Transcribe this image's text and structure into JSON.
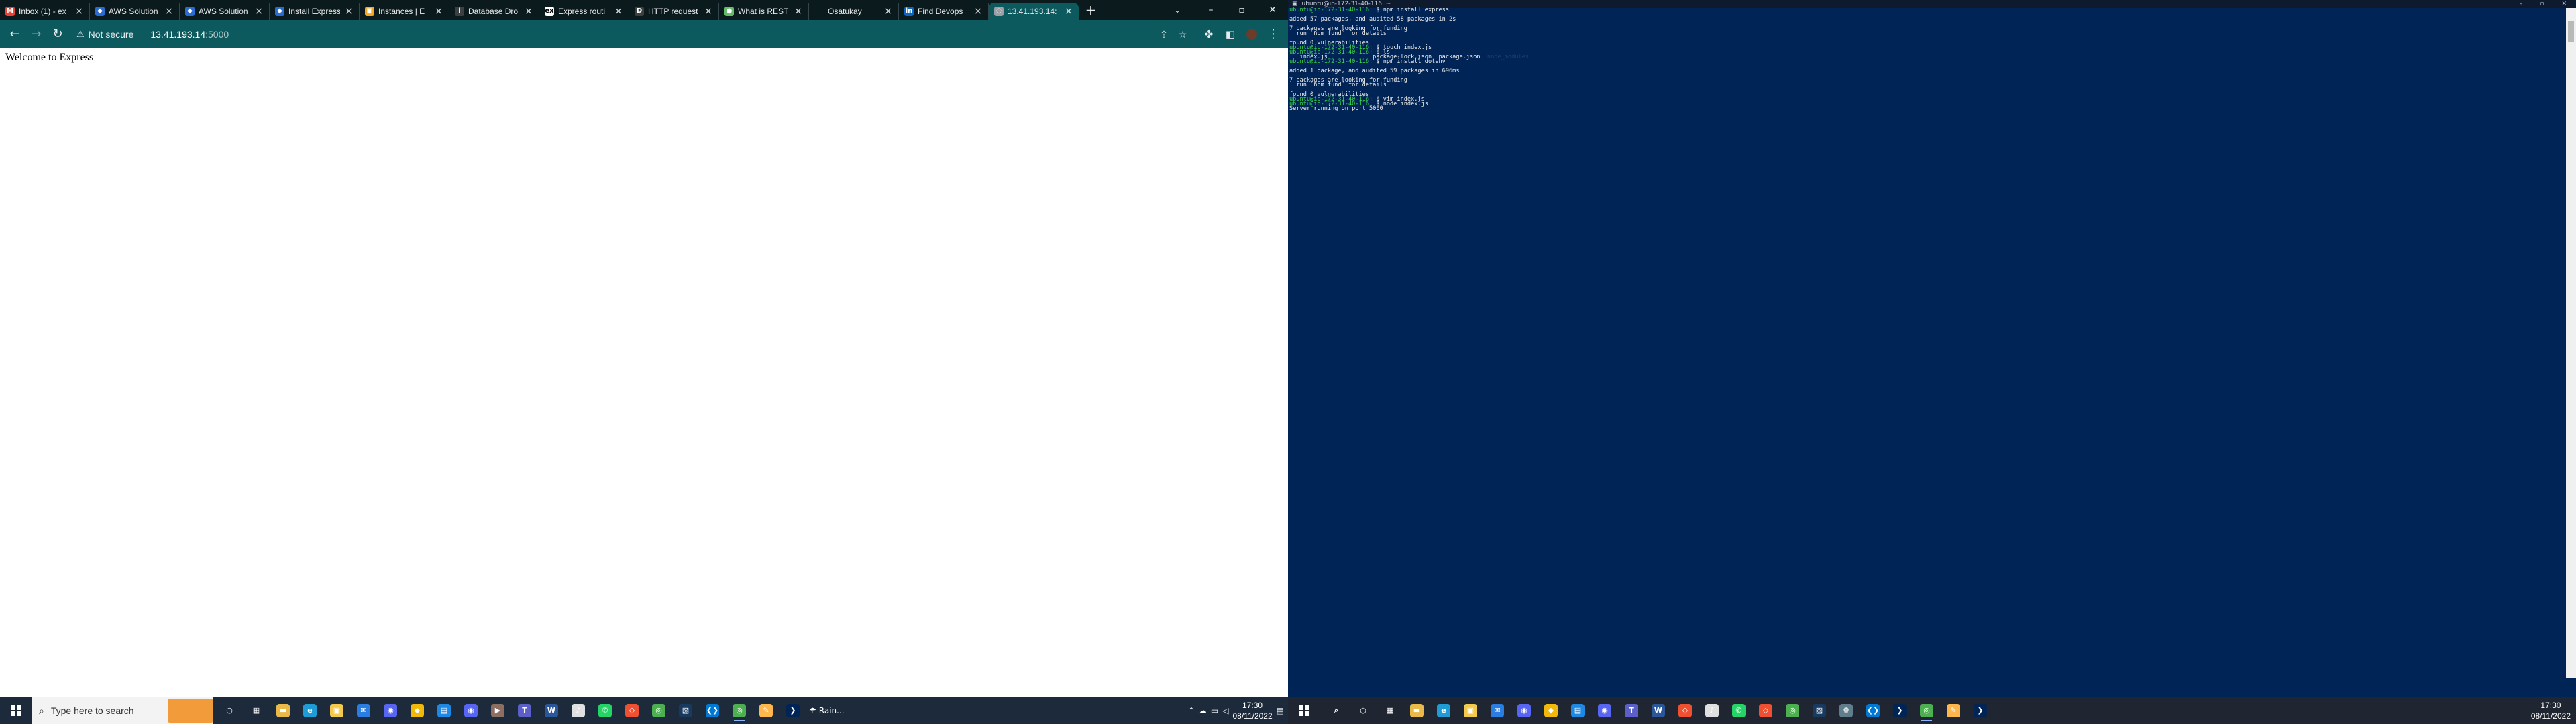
{
  "browser": {
    "tabs": [
      {
        "label": "Inbox (1) - ex",
        "icon": "gmail-icon",
        "color": "#ea4335",
        "glyph": "M"
      },
      {
        "label": "AWS Solution",
        "icon": "aws-icon",
        "color": "#2b6cd4",
        "glyph": "◆"
      },
      {
        "label": "AWS Solution",
        "icon": "aws-icon",
        "color": "#2b6cd4",
        "glyph": "◆"
      },
      {
        "label": "Install Express",
        "icon": "aws-icon",
        "color": "#2b6cd4",
        "glyph": "◆"
      },
      {
        "label": "Instances | E",
        "icon": "aws-console-icon",
        "color": "#f5a623",
        "glyph": "▣"
      },
      {
        "label": "Database Dro",
        "icon": "info-icon",
        "color": "#3c4043",
        "glyph": "i"
      },
      {
        "label": "Express routi",
        "icon": "express-icon",
        "color": "#ffffff",
        "glyph": "ex"
      },
      {
        "label": "HTTP request",
        "icon": "dev-icon",
        "color": "#3c4043",
        "glyph": "D"
      },
      {
        "label": "What is REST",
        "icon": "globe-icon",
        "color": "#66bb6a",
        "glyph": "●"
      },
      {
        "label": "Osatukay",
        "icon": "blank-icon",
        "color": "#0b1a1c",
        "glyph": ""
      },
      {
        "label": "Find Devops",
        "icon": "linkedin-icon",
        "color": "#0a66c2",
        "glyph": "in"
      },
      {
        "label": "13.41.193.14:",
        "icon": "page-icon",
        "color": "#9aa0a6",
        "glyph": "◌",
        "active": true
      }
    ],
    "new_tab_glyph": "+",
    "address": {
      "security": "Not secure",
      "host": "13.41.193.14",
      "port": ":5000"
    },
    "page": {
      "heading": "Welcome to Express"
    }
  },
  "taskbar_left": {
    "search_placeholder": "Type here to search",
    "weather": "Rain...",
    "time": "17:30",
    "date": "08/11/2022",
    "apps": [
      {
        "name": "cortana-icon",
        "color": "#1c2a3b",
        "glyph": "○"
      },
      {
        "name": "task-view-icon",
        "color": "#1c2a3b",
        "glyph": "▦"
      },
      {
        "name": "file-explorer-icon",
        "color": "#e9b949",
        "glyph": "▬"
      },
      {
        "name": "edge-icon",
        "color": "#1f9cd6",
        "glyph": "e"
      },
      {
        "name": "store-icon",
        "color": "#f2c94c",
        "glyph": "▣"
      },
      {
        "name": "mail-icon",
        "color": "#2a7de1",
        "glyph": "✉"
      },
      {
        "name": "discord-icon",
        "color": "#5865f2",
        "glyph": "◉"
      },
      {
        "name": "binance-icon",
        "color": "#f0b90b",
        "glyph": "◆"
      },
      {
        "name": "app-blue-icon",
        "color": "#1e88e5",
        "glyph": "▤"
      },
      {
        "name": "discord-icon",
        "color": "#5865f2",
        "glyph": "◉"
      },
      {
        "name": "media-icon",
        "color": "#8d6e63",
        "glyph": "▶"
      },
      {
        "name": "teams-icon",
        "color": "#5b5fc7",
        "glyph": "T"
      },
      {
        "name": "word-icon",
        "color": "#2b579a",
        "glyph": "W"
      },
      {
        "name": "itunes-icon",
        "color": "#e0e0e0",
        "glyph": "♪"
      },
      {
        "name": "whatsapp-icon",
        "color": "#25d366",
        "glyph": "✆"
      },
      {
        "name": "git-icon",
        "color": "#f05032",
        "glyph": "◇"
      },
      {
        "name": "chrome-icon",
        "color": "#4caf50",
        "glyph": "◎"
      },
      {
        "name": "virtualbox-icon",
        "color": "#183a61",
        "glyph": "▨"
      },
      {
        "name": "vscode-icon",
        "color": "#0078d4",
        "glyph": "❮❯"
      },
      {
        "name": "chrome-icon",
        "color": "#4caf50",
        "glyph": "◎",
        "running": true
      },
      {
        "name": "notepad-icon",
        "color": "#ffb74d",
        "glyph": "✎"
      },
      {
        "name": "powershell-icon",
        "color": "#012456",
        "glyph": "❯"
      }
    ]
  },
  "terminal": {
    "title": "ubuntu@ip-172-31-40-116: ~",
    "lines": [
      {
        "prompt": "ubuntu@ip-172-31-40-116:",
        "cmd": " $ npm install express"
      },
      {
        "text": ""
      },
      {
        "text": "added 57 packages, and audited 58 packages in 2s"
      },
      {
        "text": ""
      },
      {
        "text": "7 packages are looking for funding"
      },
      {
        "text": "  run `npm fund` for details"
      },
      {
        "text": ""
      },
      {
        "text": "found 0 vulnerabilities"
      },
      {
        "prompt": "ubuntu@ip-172-31-40-116:",
        "cmd": " $ touch index.js"
      },
      {
        "prompt": "ubuntu@ip-172-31-40-116:",
        "cmd": " $ ls"
      },
      {
        "text": "   index.js             package-lock.json  package.json  ",
        "dim": "node_modules"
      },
      {
        "prompt": "ubuntu@ip-172-31-40-116:",
        "cmd": " $ npm install dotenv"
      },
      {
        "text": ""
      },
      {
        "text": "added 1 package, and audited 59 packages in 696ms"
      },
      {
        "text": ""
      },
      {
        "text": "7 packages are looking for funding"
      },
      {
        "text": "  run `npm fund` for details"
      },
      {
        "text": ""
      },
      {
        "text": "found 0 vulnerabilities"
      },
      {
        "prompt": "ubuntu@ip-172-31-40-116:",
        "cmd": " $ vim index.js"
      },
      {
        "prompt": "ubuntu@ip-172-31-40-116:",
        "cmd": " $ node index.js"
      },
      {
        "text": "Server running on port 5000"
      }
    ]
  },
  "taskbar_right": {
    "time": "17:30",
    "date": "08/11/2022",
    "apps": [
      {
        "name": "search-icon",
        "color": "#1f2631",
        "glyph": "⌕"
      },
      {
        "name": "cortana-icon",
        "color": "#1f2631",
        "glyph": "○"
      },
      {
        "name": "task-view-icon",
        "color": "#1f2631",
        "glyph": "▦"
      },
      {
        "name": "file-explorer-icon",
        "color": "#e9b949",
        "glyph": "▬"
      },
      {
        "name": "edge-icon",
        "color": "#1f9cd6",
        "glyph": "e"
      },
      {
        "name": "store-icon",
        "color": "#f2c94c",
        "glyph": "▣"
      },
      {
        "name": "mail-icon",
        "color": "#2a7de1",
        "glyph": "✉"
      },
      {
        "name": "discord-icon",
        "color": "#5865f2",
        "glyph": "◉"
      },
      {
        "name": "binance-icon",
        "color": "#f0b90b",
        "glyph": "◆"
      },
      {
        "name": "app-blue-icon",
        "color": "#1e88e5",
        "glyph": "▤"
      },
      {
        "name": "discord-icon",
        "color": "#5865f2",
        "glyph": "◉"
      },
      {
        "name": "teams-icon",
        "color": "#5b5fc7",
        "glyph": "T"
      },
      {
        "name": "word-icon",
        "color": "#2b579a",
        "glyph": "W"
      },
      {
        "name": "git-icon",
        "color": "#f05032",
        "glyph": "◇"
      },
      {
        "name": "itunes-icon",
        "color": "#e0e0e0",
        "glyph": "♪"
      },
      {
        "name": "whatsapp-icon",
        "color": "#25d366",
        "glyph": "✆"
      },
      {
        "name": "git-icon",
        "color": "#f05032",
        "glyph": "◇"
      },
      {
        "name": "chrome-icon",
        "color": "#4caf50",
        "glyph": "◎"
      },
      {
        "name": "virtualbox-icon",
        "color": "#183a61",
        "glyph": "▨"
      },
      {
        "name": "settings-icon",
        "color": "#607d8b",
        "glyph": "⚙"
      },
      {
        "name": "vscode-icon",
        "color": "#0078d4",
        "glyph": "❮❯"
      },
      {
        "name": "powershell-icon",
        "color": "#012456",
        "glyph": "❯"
      },
      {
        "name": "chrome-icon",
        "color": "#4caf50",
        "glyph": "◎",
        "running": true
      },
      {
        "name": "notepad-icon",
        "color": "#ffb74d",
        "glyph": "✎"
      },
      {
        "name": "powershell-icon",
        "color": "#012456",
        "glyph": "❯"
      }
    ]
  }
}
